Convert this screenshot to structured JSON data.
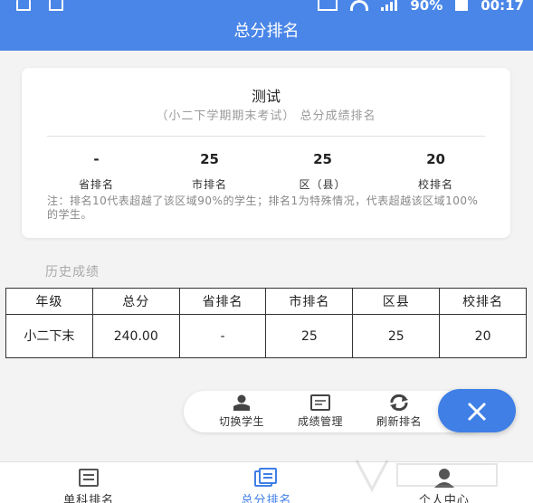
{
  "status_bar": {
    "battery": "90%",
    "time": "00:17"
  },
  "app_bar": {
    "title": "总分排名"
  },
  "summary": {
    "student": "测试",
    "exam": "（小二下学期期末考试）  总分成绩排名",
    "ranks": [
      {
        "value": "-",
        "label": "省排名"
      },
      {
        "value": "25",
        "label": "市排名"
      },
      {
        "value": "25",
        "label": "区（县）"
      },
      {
        "value": "20",
        "label": "校排名"
      }
    ],
    "note": "注：排名10代表超越了该区域90%的学生；排名1为特殊情况，代表超越该区域100%的学生。"
  },
  "history": {
    "title": "历史成绩",
    "columns": [
      "年级",
      "总分",
      "省排名",
      "市排名",
      "区县",
      "校排名"
    ],
    "rows": [
      [
        "小二下末",
        "240.00",
        "-",
        "25",
        "25",
        "20"
      ]
    ]
  },
  "fab_menu": {
    "items": [
      {
        "label": "切换学生",
        "icon": "student-icon"
      },
      {
        "label": "成绩管理",
        "icon": "score-card-icon"
      },
      {
        "label": "刷新排名",
        "icon": "refresh-icon"
      }
    ],
    "close_icon": "close-icon"
  },
  "bottom_nav": {
    "items": [
      {
        "label": "单科排名",
        "icon": "document-icon",
        "active": false
      },
      {
        "label": "总分排名",
        "icon": "documents-icon",
        "active": true
      },
      {
        "label": "个人中心",
        "icon": "user-icon",
        "active": false
      }
    ]
  },
  "colors": {
    "primary": "#4a86e8",
    "accent": "#3f7fe6",
    "background": "#f3f3f3"
  }
}
